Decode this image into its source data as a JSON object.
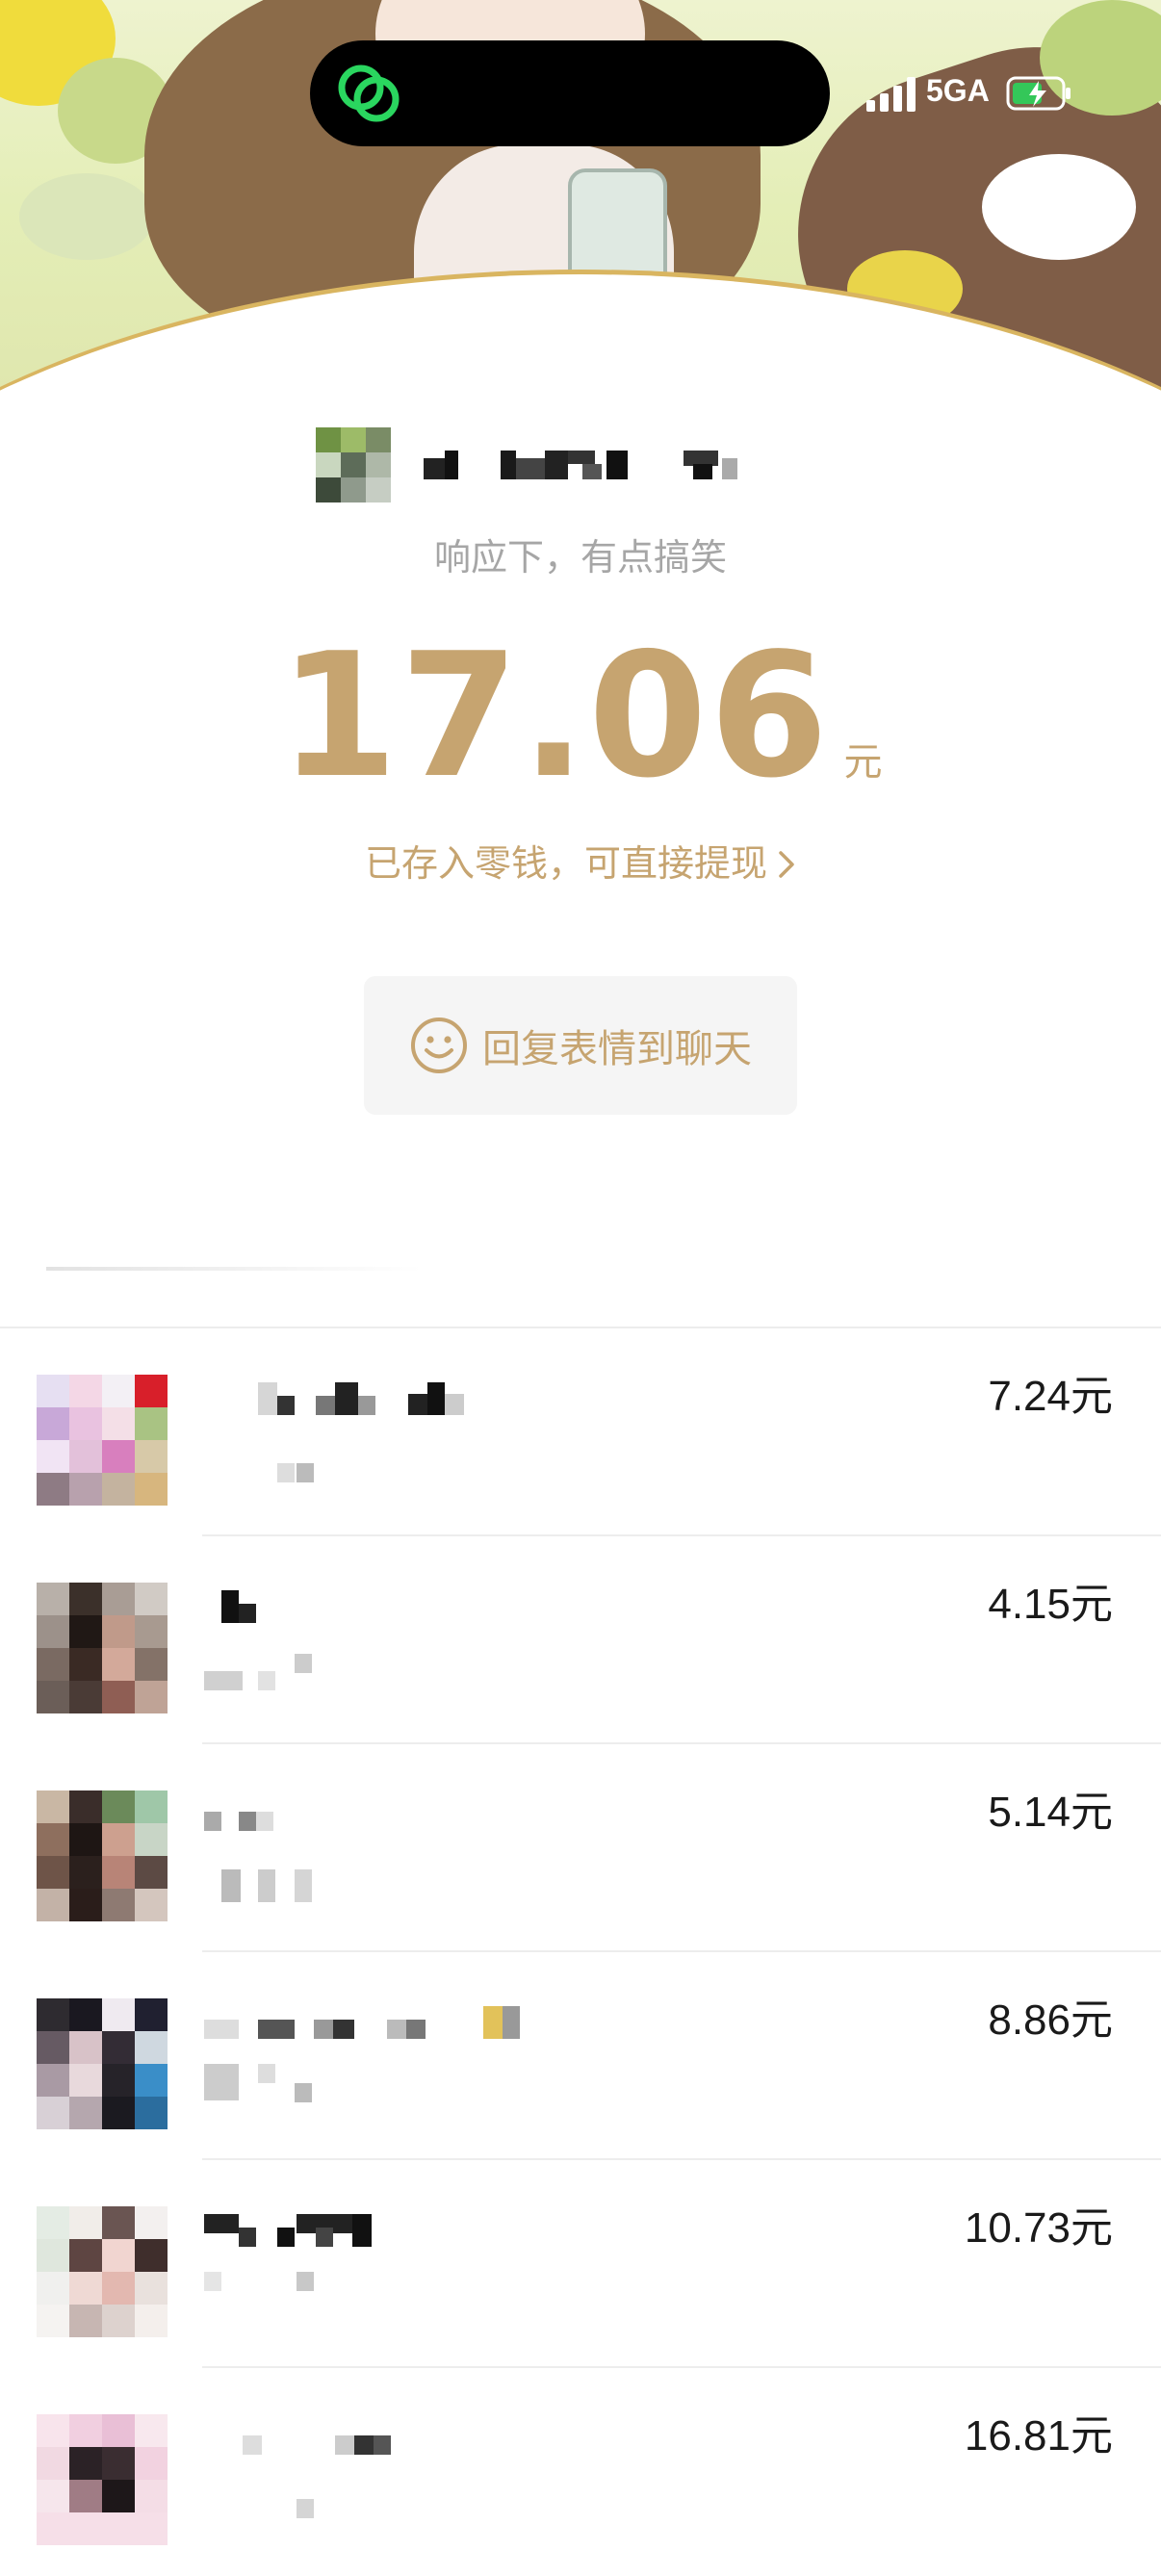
{
  "status_bar": {
    "app_icon": "wechat-icon",
    "network": "5GA",
    "battery": "charging-battery-icon"
  },
  "header": {
    "subtitle": "响应下，有点搞笑",
    "amount": "17.06",
    "unit": "元",
    "wallet_link": "已存入零钱，可直接提现",
    "wallet_link_icon": "chevron-right-icon",
    "reply_button": "回复表情到聊天",
    "reply_icon": "smile-icon"
  },
  "colors": {
    "accent_gold": "#c6a470",
    "subtitle_gray": "#a6a6a6",
    "amount_text": "#1a1a1a"
  },
  "claims": [
    {
      "amount": "7.24",
      "unit": "元"
    },
    {
      "amount": "4.15",
      "unit": "元"
    },
    {
      "amount": "5.14",
      "unit": "元"
    },
    {
      "amount": "8.86",
      "unit": "元"
    },
    {
      "amount": "10.73",
      "unit": "元"
    },
    {
      "amount": "16.81",
      "unit": "元"
    }
  ]
}
